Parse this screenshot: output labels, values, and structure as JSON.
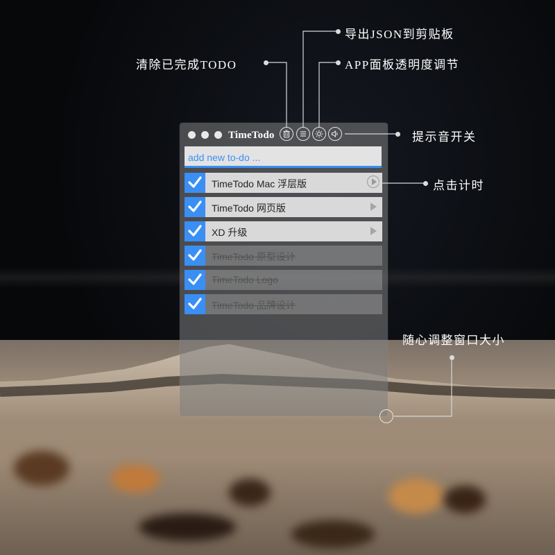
{
  "app": {
    "title": "TimeTodo",
    "input_placeholder": "add new to-do ..."
  },
  "toolbar": {
    "icons": [
      "trash-icon",
      "list-icon",
      "gear-icon",
      "sound-icon"
    ]
  },
  "todos": [
    {
      "label": "TimeTodo Mac 浮层版",
      "done": false
    },
    {
      "label": "TimeTodo 网页版",
      "done": false
    },
    {
      "label": "XD 升级",
      "done": false
    },
    {
      "label": "TimeTodo 原型设计",
      "done": true
    },
    {
      "label": "TimeTodo Logo",
      "done": true
    },
    {
      "label": "TimeTodo 品牌设计",
      "done": true
    }
  ],
  "annotations": {
    "clear_done": "清除已完成TODO",
    "export_json": "导出JSON到剪贴板",
    "opacity": "APP面板透明度调节",
    "sound": "提示音开关",
    "timer": "点击计时",
    "resize": "随心调整窗口大小"
  },
  "colors": {
    "accent": "#3a8ff5",
    "callout_text": "#ffffff"
  }
}
